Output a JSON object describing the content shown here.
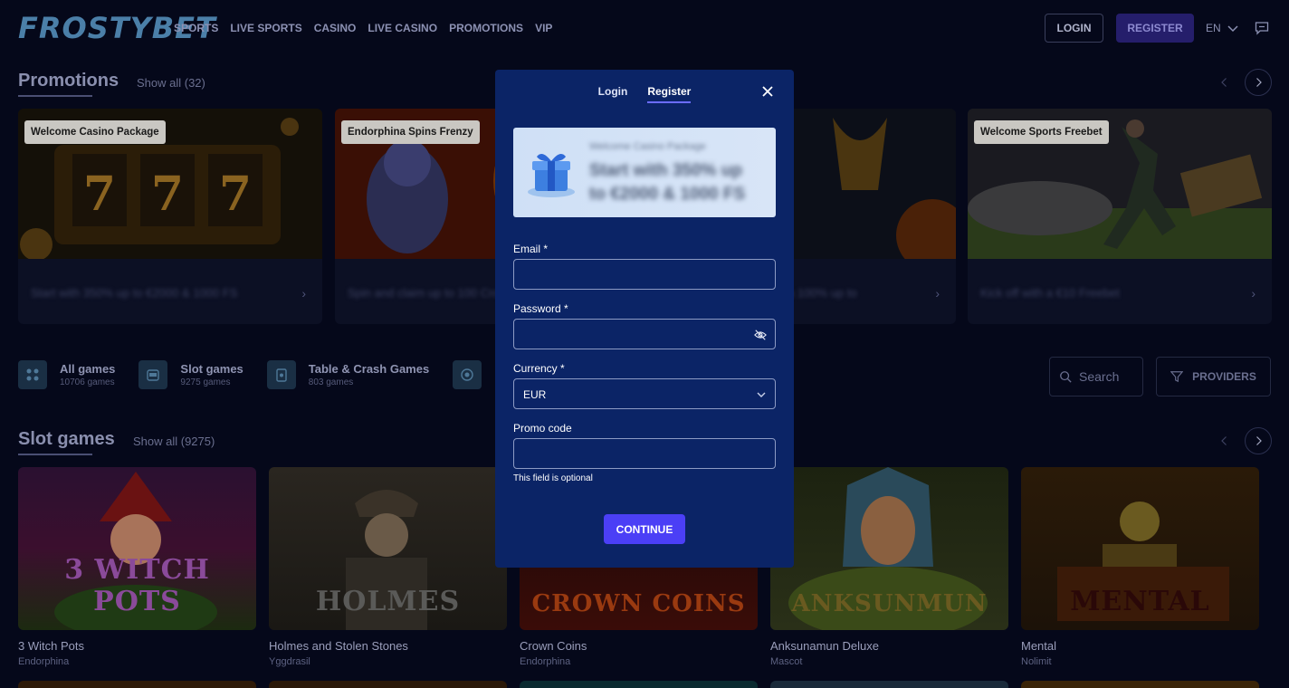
{
  "header": {
    "logo_text": "FROSTYBET",
    "nav": [
      "SPORTS",
      "LIVE SPORTS",
      "CASINO",
      "LIVE CASINO",
      "PROMOTIONS",
      "VIP"
    ],
    "login_label": "LOGIN",
    "register_label": "REGISTER",
    "language": "EN"
  },
  "promotions": {
    "title": "Promotions",
    "show_all": "Show all (32)",
    "cards": [
      {
        "tag": "Welcome Casino Package",
        "text": "Start with 350% up to €2000 & 1000 FS"
      },
      {
        "tag": "Endorphina Spins Frenzy",
        "text": "Spin and claim up to 100 Crown Coins"
      },
      {
        "tag": "",
        "text": "a 100% up to"
      },
      {
        "tag": "Welcome Sports Freebet",
        "text": "Kick off with a €10 Freebet"
      }
    ]
  },
  "categories": [
    {
      "name": "All games",
      "count": "10706 games",
      "icon": "grid-icon"
    },
    {
      "name": "Slot games",
      "count": "9275 games",
      "icon": "slot-machine-icon"
    },
    {
      "name": "Table & Crash Games",
      "count": "803 games",
      "icon": "cards-icon"
    },
    {
      "name": "",
      "count": "",
      "icon": "roulette-icon"
    }
  ],
  "search": {
    "placeholder": "Search"
  },
  "providers_label": "PROVIDERS",
  "slot_games": {
    "title": "Slot games",
    "show_all": "Show all (9275)",
    "games": [
      {
        "name": "3 Witch Pots",
        "provider": "Endorphina",
        "art_text": "3 WITCH POTS"
      },
      {
        "name": "Holmes and Stolen Stones",
        "provider": "Yggdrasil",
        "art_text": "HOLMES"
      },
      {
        "name": "Crown Coins",
        "provider": "Endorphina",
        "art_text": "CROWN COINS"
      },
      {
        "name": "Anksunamun Deluxe",
        "provider": "Mascot",
        "art_text": "ANKSUNMUN"
      },
      {
        "name": "Mental",
        "provider": "Nolimit",
        "art_text": "MENTAL"
      }
    ]
  },
  "modal": {
    "tabs": [
      "Login",
      "Register"
    ],
    "active_tab": "Register",
    "banner": {
      "small": "Welcome Casino Package",
      "big": "Start with 350% up to €2000 & 1000 FS"
    },
    "email_label": "Email *",
    "password_label": "Password *",
    "currency_label": "Currency *",
    "currency_value": "EUR",
    "promo_label": "Promo code",
    "promo_hint": "This field is optional",
    "continue_label": "CONTINUE"
  },
  "colors": {
    "modal_bg": "#0b2466",
    "accent": "#4b3ff6",
    "page_bg": "#05081a"
  }
}
